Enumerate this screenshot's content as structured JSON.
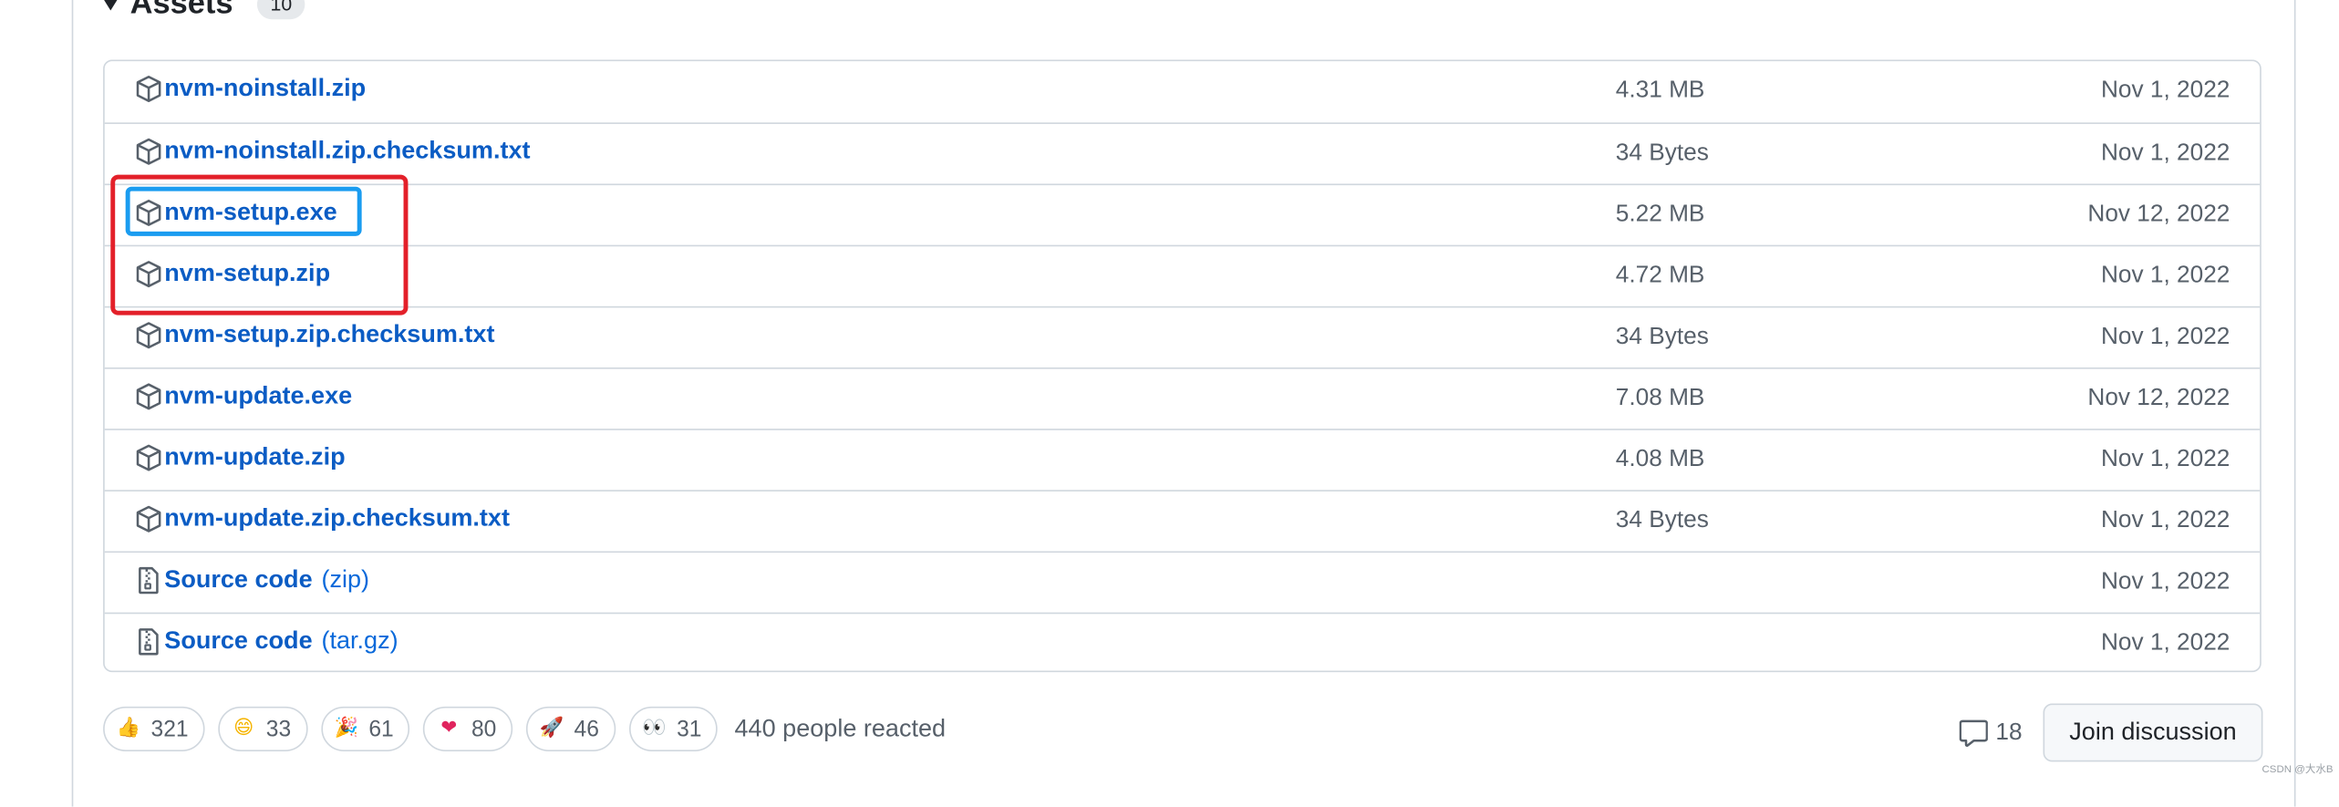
{
  "assets": {
    "title": "Assets",
    "count": "10",
    "items": [
      {
        "name": "nvm-noinstall.zip",
        "suffix": "",
        "size": "4.31 MB",
        "date": "Nov 1, 2022",
        "icon": "package-icon"
      },
      {
        "name": "nvm-noinstall.zip.checksum.txt",
        "suffix": "",
        "size": "34 Bytes",
        "date": "Nov 1, 2022",
        "icon": "package-icon"
      },
      {
        "name": "nvm-setup.exe",
        "suffix": "",
        "size": "5.22 MB",
        "date": "Nov 12, 2022",
        "icon": "package-icon"
      },
      {
        "name": "nvm-setup.zip",
        "suffix": "",
        "size": "4.72 MB",
        "date": "Nov 1, 2022",
        "icon": "package-icon"
      },
      {
        "name": "nvm-setup.zip.checksum.txt",
        "suffix": "",
        "size": "34 Bytes",
        "date": "Nov 1, 2022",
        "icon": "package-icon"
      },
      {
        "name": "nvm-update.exe",
        "suffix": "",
        "size": "7.08 MB",
        "date": "Nov 12, 2022",
        "icon": "package-icon"
      },
      {
        "name": "nvm-update.zip",
        "suffix": "",
        "size": "4.08 MB",
        "date": "Nov 1, 2022",
        "icon": "package-icon"
      },
      {
        "name": "nvm-update.zip.checksum.txt",
        "suffix": "",
        "size": "34 Bytes",
        "date": "Nov 1, 2022",
        "icon": "package-icon"
      },
      {
        "name": "Source code",
        "suffix": "(zip)",
        "size": "",
        "date": "Nov 1, 2022",
        "icon": "file-zip-icon"
      },
      {
        "name": "Source code",
        "suffix": "(tar.gz)",
        "size": "",
        "date": "Nov 1, 2022",
        "icon": "file-zip-icon"
      }
    ]
  },
  "reactions": {
    "items": [
      {
        "emoji": "👍",
        "icon": "thumbs-up-icon",
        "count": "321"
      },
      {
        "emoji": "😄",
        "icon": "laugh-icon",
        "count": "33"
      },
      {
        "emoji": "🎉",
        "icon": "hooray-icon",
        "count": "61"
      },
      {
        "emoji": "❤",
        "icon": "heart-icon",
        "count": "80"
      },
      {
        "emoji": "🚀",
        "icon": "rocket-icon",
        "count": "46"
      },
      {
        "emoji": "👀",
        "icon": "eyes-icon",
        "count": "31"
      }
    ],
    "summary": "440 people reacted"
  },
  "discussion": {
    "comment_count": "18",
    "join_label": "Join discussion"
  },
  "colors": {
    "link": "#0969da",
    "highlight_red": "#e3202a",
    "highlight_blue": "#1a9cf0",
    "border": "#d0d7de",
    "muted_text": "#57606a"
  },
  "watermark": "CSDN @大水B"
}
